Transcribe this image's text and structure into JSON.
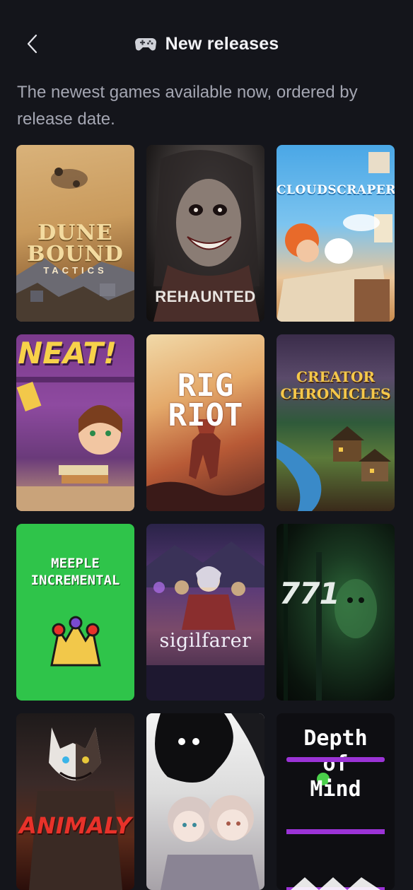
{
  "header": {
    "back_label": "",
    "title": "New releases",
    "title_icon": "gamepad-icon"
  },
  "subtitle": "The newest games available now, ordered by release date.",
  "games": [
    {
      "id": "dune-bound",
      "title": "DUNE BOUND",
      "tagline": "TACTICS"
    },
    {
      "id": "rehaunted",
      "title": "REHAUNTED"
    },
    {
      "id": "cloudscrapers",
      "title": "CLOUDSCRAPERS"
    },
    {
      "id": "neat",
      "title": "NEAT!"
    },
    {
      "id": "rig-riot",
      "title": "RIG RIOT"
    },
    {
      "id": "creator-chronicles",
      "title": "CREATOR CHRONICLES"
    },
    {
      "id": "meeple-incremental",
      "title": "MEEPLE INCREMENTAL"
    },
    {
      "id": "sigilfarer",
      "title": "sigilfarer"
    },
    {
      "id": "771",
      "title": "771"
    },
    {
      "id": "animaly",
      "title": "ANIMALY"
    },
    {
      "id": "untitled-anime",
      "title": ""
    },
    {
      "id": "depth-of-mind",
      "title": "Depth of Mind"
    }
  ],
  "colors": {
    "background": "#14151b",
    "subtitle": "#a4a6b2",
    "title": "#f2f2f6"
  }
}
